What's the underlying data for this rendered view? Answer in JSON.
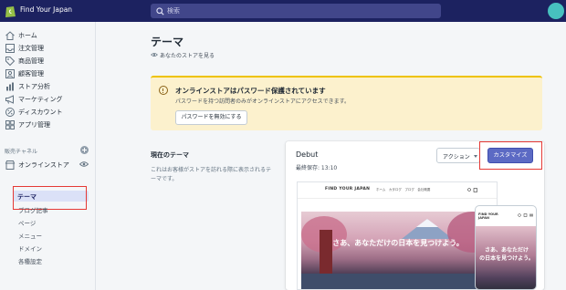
{
  "topbar": {
    "store_name": "Find Your Japan",
    "search_placeholder": "検索"
  },
  "sidebar": {
    "items": [
      {
        "label": "ホーム",
        "icon": "home-icon"
      },
      {
        "label": "注文管理",
        "icon": "orders-icon"
      },
      {
        "label": "商品管理",
        "icon": "tag-icon"
      },
      {
        "label": "顧客管理",
        "icon": "customers-icon"
      },
      {
        "label": "ストア分析",
        "icon": "analytics-icon"
      },
      {
        "label": "マーケティング",
        "icon": "megaphone-icon"
      },
      {
        "label": "ディスカウント",
        "icon": "discount-icon"
      },
      {
        "label": "アプリ管理",
        "icon": "apps-icon"
      }
    ],
    "channel_heading": "販売チャネル",
    "online_store": "オンラインストア",
    "sub_items": [
      "テーマ",
      "ブログ記事",
      "ページ",
      "メニュー",
      "ドメイン",
      "各種設定"
    ]
  },
  "main": {
    "title": "テーマ",
    "view_store": "あなたのストアを見る",
    "banner": {
      "title": "オンラインストアはパスワード保護されています",
      "text": "パスワードを持つ訪問者のみがオンラインストアにアクセスできます。",
      "button": "パスワードを無効にする"
    },
    "current_theme": {
      "heading": "現在のテーマ",
      "description": "これはお客様がストアを訪れる際に表示されるテーマです。"
    },
    "card": {
      "theme_name": "Debut",
      "last_saved": "最終保存: 13:10",
      "action_label": "アクション",
      "customize_label": "カスタマイズ"
    },
    "preview": {
      "brand": "FIND YOUR JAPAN",
      "nav_links": "ホーム　カタログ　ブログ　会社概要",
      "headline": "さあ、あなただけの日本を見つけよう。",
      "mobile_brand_line1": "FIND YOUR",
      "mobile_brand_line2": "JAPAN",
      "mobile_headline_line1": "さあ、あなただけ",
      "mobile_headline_line2": "の日本を見つけよう。"
    }
  },
  "colors": {
    "topbar": "#1c2260",
    "accent": "#5c6ac4",
    "banner": "#fcf1cd",
    "highlight": "#e53935"
  }
}
